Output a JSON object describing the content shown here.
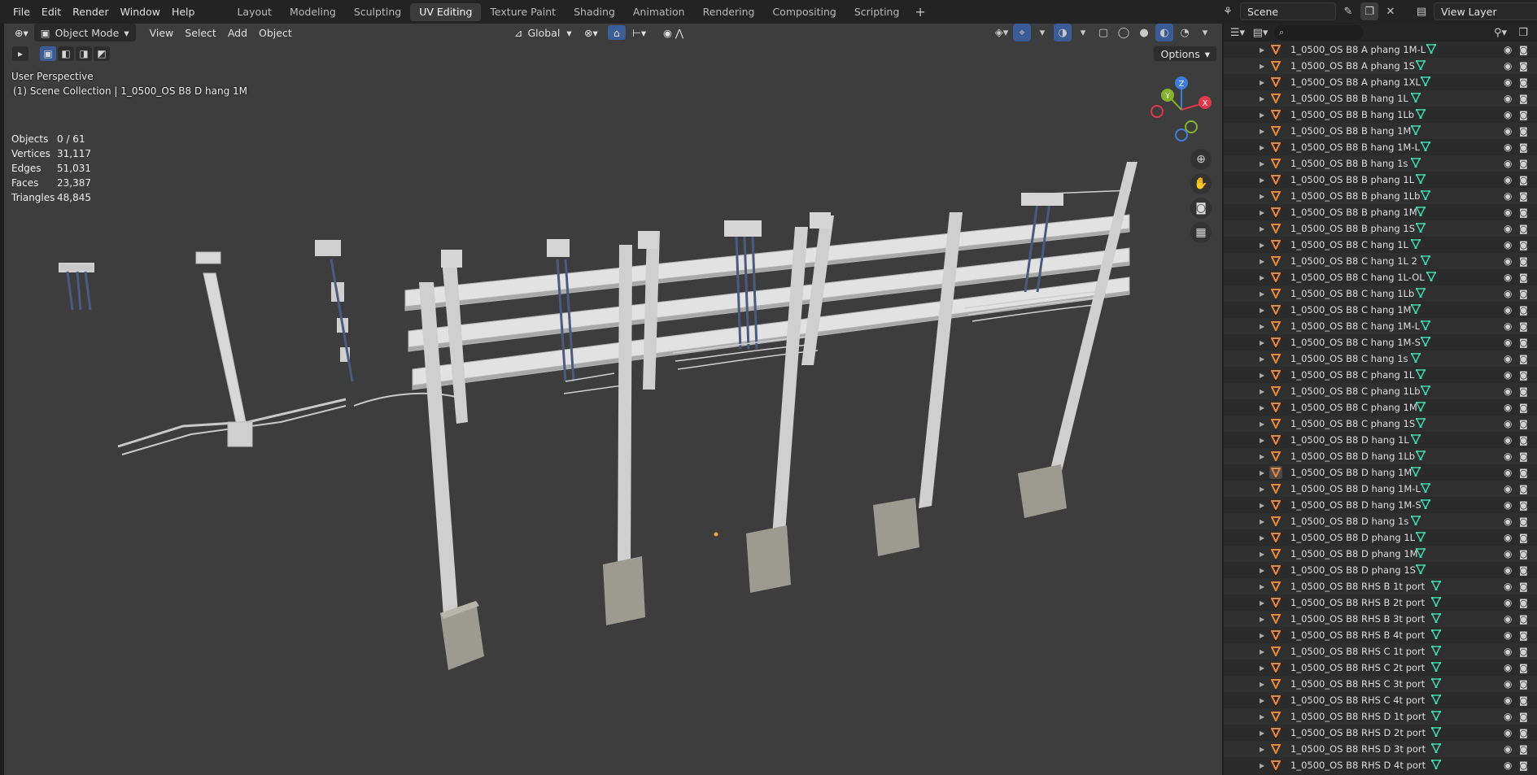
{
  "menu": [
    "File",
    "Edit",
    "Render",
    "Window",
    "Help"
  ],
  "workspaces": [
    {
      "label": "Layout",
      "active": false
    },
    {
      "label": "Modeling",
      "active": false
    },
    {
      "label": "Sculpting",
      "active": false
    },
    {
      "label": "UV Editing",
      "active": true
    },
    {
      "label": "Texture Paint",
      "active": false
    },
    {
      "label": "Shading",
      "active": false
    },
    {
      "label": "Animation",
      "active": false
    },
    {
      "label": "Rendering",
      "active": false
    },
    {
      "label": "Compositing",
      "active": false
    },
    {
      "label": "Scripting",
      "active": false
    }
  ],
  "scene": {
    "name": "Scene",
    "view_layer": "View Layer"
  },
  "viewport": {
    "mode": "Object Mode",
    "menu": [
      "View",
      "Select",
      "Add",
      "Object"
    ],
    "transform_orientation": "Global",
    "options_label": "Options",
    "perspective": "User Perspective",
    "collection_info": "(1) Scene Collection | 1_0500_OS B8 D hang 1M",
    "stats": [
      {
        "label": "Objects",
        "value": "0 / 61"
      },
      {
        "label": "Vertices",
        "value": "31,117"
      },
      {
        "label": "Edges",
        "value": "51,031"
      },
      {
        "label": "Faces",
        "value": "23,387"
      },
      {
        "label": "Triangles",
        "value": "48,845"
      }
    ],
    "gizmo": {
      "x": "X",
      "y": "Y",
      "z": "Z"
    },
    "colors": {
      "x_axis": "#e2384b",
      "y_axis": "#86b32e",
      "z_axis": "#3d7fe0"
    }
  },
  "outliner": {
    "items": [
      "1_0500_OS B8 A phang 1M-L",
      "1_0500_OS B8 A phang 1S",
      "1_0500_OS B8 A phang 1XL",
      "1_0500_OS B8 B hang 1L",
      "1_0500_OS B8 B hang 1Lb",
      "1_0500_OS B8 B hang 1M",
      "1_0500_OS B8 B hang 1M-L",
      "1_0500_OS B8 B hang 1s",
      "1_0500_OS B8 B phang 1L",
      "1_0500_OS B8 B phang 1Lb",
      "1_0500_OS B8 B phang 1M",
      "1_0500_OS B8 B phang 1S",
      "1_0500_OS B8 C hang 1L",
      "1_0500_OS B8 C hang 1L 2",
      "1_0500_OS B8 C hang 1L-OL",
      "1_0500_OS B8 C hang 1Lb",
      "1_0500_OS B8 C hang 1M",
      "1_0500_OS B8 C hang 1M-L",
      "1_0500_OS B8 C hang 1M-S",
      "1_0500_OS B8 C hang 1s",
      "1_0500_OS B8 C phang 1L",
      "1_0500_OS B8 C phang 1Lb",
      "1_0500_OS B8 C phang 1M",
      "1_0500_OS B8 C phang 1S",
      "1_0500_OS B8 D hang 1L",
      "1_0500_OS B8 D hang 1Lb",
      "1_0500_OS B8 D hang 1M",
      "1_0500_OS B8 D hang 1M-L",
      "1_0500_OS B8 D hang 1M-S",
      "1_0500_OS B8 D hang 1s",
      "1_0500_OS B8 D phang 1L",
      "1_0500_OS B8 D phang 1M",
      "1_0500_OS B8 D phang 1S",
      "1_0500_OS B8 RHS B 1t port",
      "1_0500_OS B8 RHS B 2t port",
      "1_0500_OS B8 RHS B 3t port",
      "1_0500_OS B8 RHS B 4t port",
      "1_0500_OS B8 RHS C 1t port",
      "1_0500_OS B8 RHS C 2t port",
      "1_0500_OS B8 RHS C 3t port",
      "1_0500_OS B8 RHS C 4t port",
      "1_0500_OS B8 RHS D 1t port",
      "1_0500_OS B8 RHS D 2t port",
      "1_0500_OS B8 RHS D 3t port",
      "1_0500_OS B8 RHS D 4t port"
    ],
    "active_item": "1_0500_OS B8 D hang 1M",
    "colors": {
      "object_icon": "#e8883a",
      "mesh_icon": "#3fd6b0"
    }
  }
}
